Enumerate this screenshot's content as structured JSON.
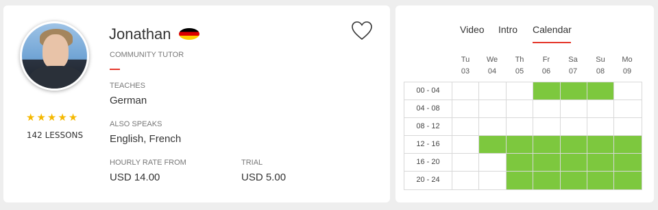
{
  "tutor": {
    "name": "Jonathan",
    "flag": "germany-flag",
    "role": "COMMUNITY TUTOR",
    "rating_stars": 5,
    "lessons": "142 LESSONS",
    "teaches_label": "TEACHES",
    "teaches": "German",
    "also_speaks_label": "ALSO SPEAKS",
    "also_speaks": "English, French",
    "hourly_label": "HOURLY RATE FROM",
    "hourly": "USD 14.00",
    "trial_label": "TRIAL",
    "trial": "USD 5.00"
  },
  "tabs": [
    {
      "label": "Video",
      "active": false
    },
    {
      "label": "Intro",
      "active": false
    },
    {
      "label": "Calendar",
      "active": true
    }
  ],
  "calendar": {
    "days": [
      {
        "dow": "Tu",
        "date": "03"
      },
      {
        "dow": "We",
        "date": "04"
      },
      {
        "dow": "Th",
        "date": "05"
      },
      {
        "dow": "Fr",
        "date": "06"
      },
      {
        "dow": "Sa",
        "date": "07"
      },
      {
        "dow": "Su",
        "date": "08"
      },
      {
        "dow": "Mo",
        "date": "09"
      }
    ],
    "slots": [
      {
        "label": "00 - 04",
        "available": [
          0,
          0,
          0,
          1,
          1,
          1,
          0
        ]
      },
      {
        "label": "04 - 08",
        "available": [
          0,
          0,
          0,
          0,
          0,
          0,
          0
        ]
      },
      {
        "label": "08 - 12",
        "available": [
          0,
          0,
          0,
          0,
          0,
          0,
          0
        ]
      },
      {
        "label": "12 - 16",
        "available": [
          0,
          1,
          1,
          1,
          1,
          1,
          1
        ]
      },
      {
        "label": "16 - 20",
        "available": [
          0,
          0,
          1,
          1,
          1,
          1,
          1
        ]
      },
      {
        "label": "20 - 24",
        "available": [
          0,
          0,
          1,
          1,
          1,
          1,
          1
        ]
      }
    ]
  },
  "colors": {
    "accent": "#e5362a",
    "available": "#7dc83e",
    "star": "#f5b800"
  }
}
